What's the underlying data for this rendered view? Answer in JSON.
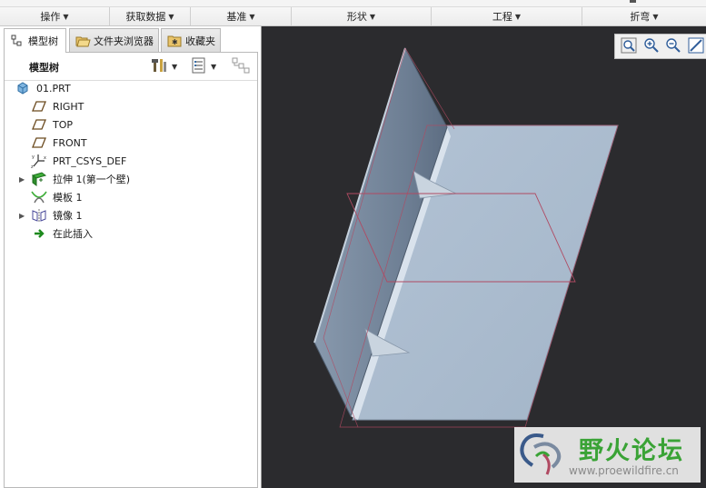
{
  "ribbon": {
    "groups": [
      {
        "label": "操作"
      },
      {
        "label": "获取数据"
      },
      {
        "label": "基准"
      },
      {
        "label": "形状"
      },
      {
        "label": "工程"
      },
      {
        "label": "折弯"
      }
    ]
  },
  "navigator": {
    "tabs": [
      {
        "label": "模型树",
        "icon": "model-tree-icon"
      },
      {
        "label": "文件夹浏览器",
        "icon": "folder-browser-icon"
      },
      {
        "label": "收藏夹",
        "icon": "favorites-icon"
      }
    ],
    "title": "模型树",
    "toolbar_icons": [
      "settings-tools-icon",
      "show-columns-icon",
      "filter-icon"
    ]
  },
  "tree": {
    "items": [
      {
        "label": "01.PRT",
        "icon": "part-icon",
        "expander": ""
      },
      {
        "label": "RIGHT",
        "icon": "datum-plane-icon",
        "expander": ""
      },
      {
        "label": "TOP",
        "icon": "datum-plane-icon",
        "expander": ""
      },
      {
        "label": "FRONT",
        "icon": "datum-plane-icon",
        "expander": ""
      },
      {
        "label": "PRT_CSYS_DEF",
        "icon": "coordinate-system-icon",
        "expander": ""
      },
      {
        "label": "拉伸 1(第一个壁)",
        "icon": "extrude-wall-icon",
        "expander": "▶"
      },
      {
        "label": "模板 1",
        "icon": "form-icon",
        "expander": ""
      },
      {
        "label": "镜像 1",
        "icon": "mirror-icon",
        "expander": "▶"
      },
      {
        "label": "在此插入",
        "icon": "insert-here-arrow-icon",
        "expander": ""
      }
    ]
  },
  "view_toolbar": {
    "buttons": [
      "zoom-to-fit-icon",
      "zoom-in-icon",
      "zoom-out-icon",
      "repaint-icon"
    ]
  },
  "watermark": {
    "title": "野火论坛",
    "url": "www.proewildfire.cn"
  },
  "colors": {
    "viewport_bg": "#2b2b2e",
    "model_surface": "#a8b9cc",
    "datum_edge": "#b04a62",
    "watermark_green": "#3aa336"
  }
}
